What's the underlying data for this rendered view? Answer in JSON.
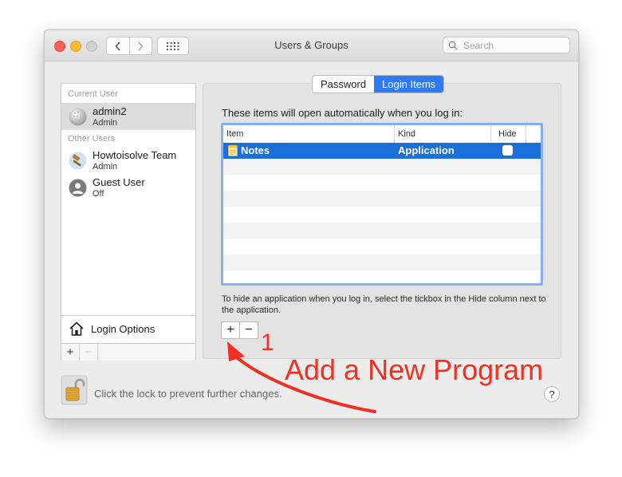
{
  "window": {
    "title": "Users & Groups"
  },
  "search": {
    "placeholder": "Search"
  },
  "sidebar": {
    "current_user_header": "Current User",
    "current_user": {
      "name": "admin2",
      "role": "Admin"
    },
    "other_users_header": "Other Users",
    "other_users": [
      {
        "name": "Howtoisolve Team",
        "role": "Admin"
      },
      {
        "name": "Guest User",
        "role": "Off"
      }
    ],
    "login_options_label": "Login Options",
    "add_label": "+",
    "remove_label": "−"
  },
  "tabs": [
    {
      "label": "Password",
      "active": false
    },
    {
      "label": "Login Items",
      "active": true
    }
  ],
  "login_items": {
    "intro": "These items will open automatically when you log in:",
    "columns": [
      "Item",
      "Kind",
      "Hide"
    ],
    "rows": [
      {
        "item": "Notes",
        "kind": "Application",
        "hide": false,
        "selected": true
      }
    ],
    "hint": "To hide an application when you log in, select the tickbox in the Hide column next to the application.",
    "add_label": "+",
    "remove_label": "−"
  },
  "lock": {
    "text": "Click the lock to prevent further changes."
  },
  "help": {
    "label": "?"
  },
  "annotation": {
    "number": "1",
    "text": "Add a New Program",
    "color": "#f03022"
  },
  "colors": {
    "accent": "#2f7bf5",
    "selection": "#1b6fd8"
  }
}
